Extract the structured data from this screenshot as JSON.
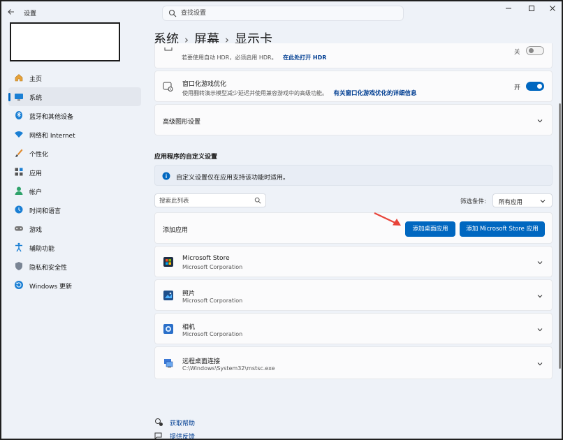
{
  "window": {
    "app_title": "设置",
    "search_placeholder": "查找设置"
  },
  "sidebar": {
    "items": [
      {
        "label": "主页",
        "active": false
      },
      {
        "label": "系统",
        "active": true
      },
      {
        "label": "蓝牙和其他设备",
        "active": false
      },
      {
        "label": "网络和 Internet",
        "active": false
      },
      {
        "label": "个性化",
        "active": false
      },
      {
        "label": "应用",
        "active": false
      },
      {
        "label": "帐户",
        "active": false
      },
      {
        "label": "时间和语言",
        "active": false
      },
      {
        "label": "游戏",
        "active": false
      },
      {
        "label": "辅助功能",
        "active": false
      },
      {
        "label": "隐私和安全性",
        "active": false
      },
      {
        "label": "Windows 更新",
        "active": false
      }
    ]
  },
  "breadcrumb": {
    "part1": "系统",
    "part2": "屏幕",
    "part3": "显示卡",
    "separator": "›"
  },
  "cards": {
    "hdr": {
      "desc": "若要使用自动 HDR，必须启用 HDR。",
      "link": "在此处打开 HDR",
      "toggle_label": "关",
      "toggle_on": false
    },
    "windowed": {
      "title": "窗口化游戏优化",
      "desc": "使用翻转演示模型减少延迟并使用兼容游戏中的高级功能。",
      "link": "有关窗口化游戏优化的详细信息",
      "toggle_label": "开",
      "toggle_on": true
    },
    "advanced": {
      "title": "高级图形设置"
    }
  },
  "custom_section": {
    "heading": "应用程序的自定义设置",
    "info": "自定义设置仅在应用支持该功能时适用。",
    "list_search_placeholder": "搜索此列表",
    "filter_label": "筛选条件:",
    "filter_value": "所有应用",
    "add_app_label": "添加应用",
    "btn_desktop": "添加桌面应用",
    "btn_store": "添加 Microsoft Store 应用"
  },
  "apps": [
    {
      "name": "Microsoft Store",
      "publisher": "Microsoft Corporation",
      "icon": "store-icon"
    },
    {
      "name": "照片",
      "publisher": "Microsoft Corporation",
      "icon": "photos-icon"
    },
    {
      "name": "相机",
      "publisher": "Microsoft Corporation",
      "icon": "camera-icon"
    },
    {
      "name": "远程桌面连接",
      "publisher": "C:\\Windows\\System32\\mstsc.exe",
      "icon": "remote-desktop-icon"
    }
  ],
  "footer": {
    "help": "获取帮助",
    "feedback": "提供反馈"
  },
  "colors": {
    "accent": "#0067c0",
    "arrow": "#e8443a"
  }
}
